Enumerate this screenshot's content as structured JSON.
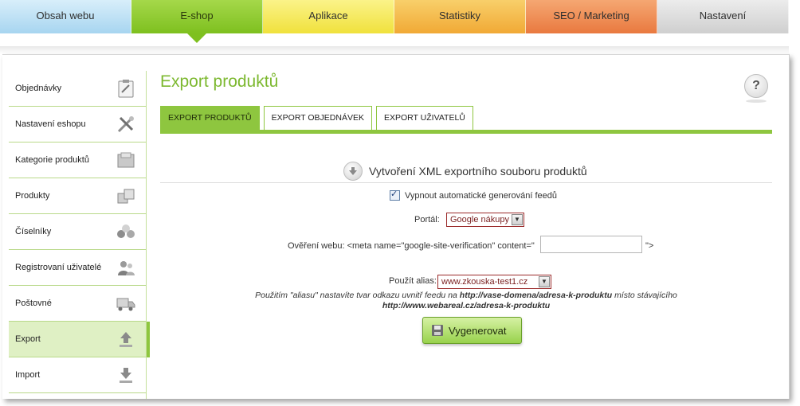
{
  "topnav": [
    {
      "label": "Obsah webu"
    },
    {
      "label": "E-shop"
    },
    {
      "label": "Aplikace"
    },
    {
      "label": "Statistiky"
    },
    {
      "label": "SEO / Marketing"
    },
    {
      "label": "Nastavení"
    }
  ],
  "sidebar": {
    "items": [
      {
        "label": "Objednávky",
        "icon": "clipboard-icon"
      },
      {
        "label": "Nastavení eshopu",
        "icon": "tools-icon"
      },
      {
        "label": "Kategorie produktů",
        "icon": "categories-icon"
      },
      {
        "label": "Produkty",
        "icon": "boxes-icon"
      },
      {
        "label": "Číselníky",
        "icon": "numbers-icon"
      },
      {
        "label": "Registrovaní uživatelé",
        "icon": "users-icon"
      },
      {
        "label": "Poštovné",
        "icon": "truck-icon"
      },
      {
        "label": "Export",
        "icon": "upload-icon"
      },
      {
        "label": "Import",
        "icon": "download-icon"
      }
    ],
    "active_index": 7
  },
  "page": {
    "title": "Export produktů",
    "help": "?"
  },
  "tabs": [
    {
      "label": "EXPORT PRODUKTŮ",
      "active": true
    },
    {
      "label": "EXPORT OBJEDNÁVEK",
      "active": false
    },
    {
      "label": "EXPORT UŽIVATELŮ",
      "active": false
    }
  ],
  "form": {
    "section_title": "Vytvoření XML exportního souboru produktů",
    "auto_feed_label": "Vypnout automatické generování feedů",
    "portal_label": "Portál:",
    "portal_value": "Google nákupy",
    "verification_label": "Ověření webu:  <meta name=\"google-site-verification\" content=\"",
    "verification_value": "",
    "verification_end": "\">",
    "alias_label": "Použít alias:",
    "alias_value": "www.zkouska-test1.cz",
    "note_prefix": "Použitím \"aliasu\" nastavíte tvar odkazu uvnitř feedu na ",
    "note_url1": "http://vase-domena/adresa-k-produktu",
    "note_middle": " místo stávajícího",
    "note_url2": "http://www.webareal.cz/adresa-k-produktu",
    "generate_button": "Vygenerovat"
  },
  "colors": {
    "accent_green": "#8ec63f",
    "title_green": "#7cb82f",
    "select_border": "#9b2b2b"
  }
}
